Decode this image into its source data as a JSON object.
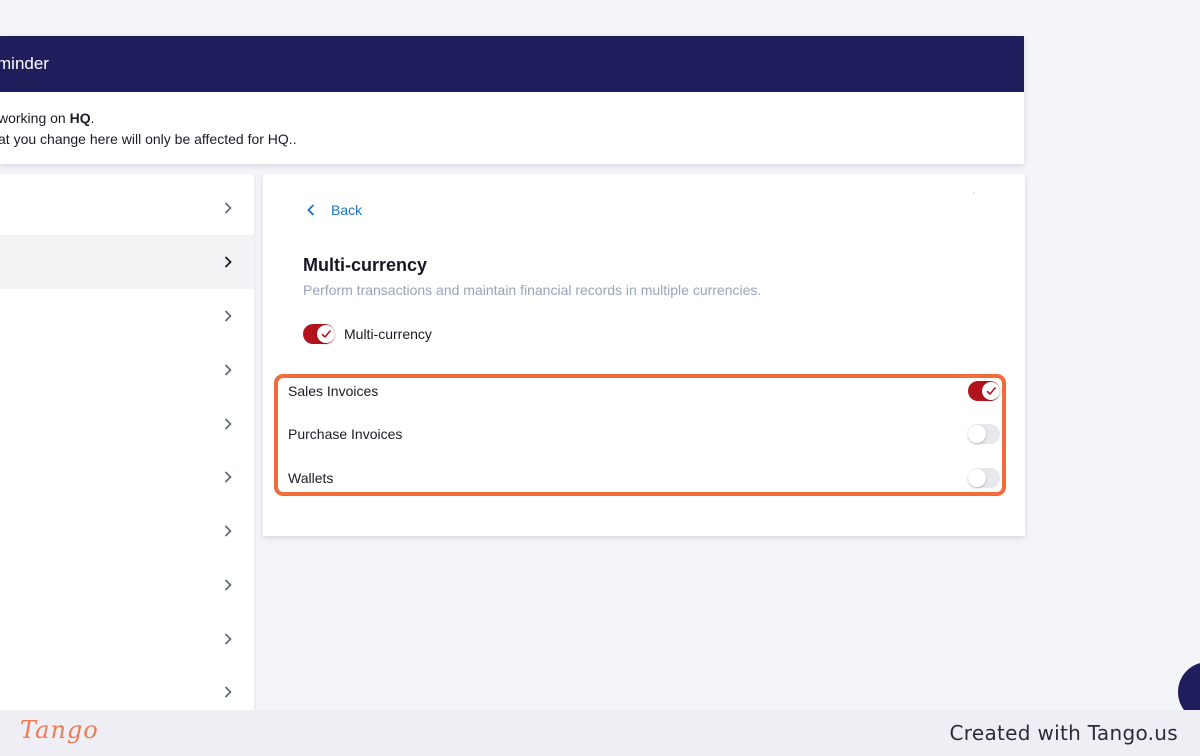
{
  "reminder": {
    "title": "minder",
    "line1_prefix": "working on ",
    "line1_bold": "HQ",
    "line1_suffix": ".",
    "line2": "at you change here will only be affected for HQ.."
  },
  "sidebar": {
    "items": [
      {
        "active": false
      },
      {
        "active": true
      },
      {
        "active": false
      },
      {
        "active": false
      },
      {
        "active": false
      },
      {
        "active": false
      },
      {
        "active": false
      },
      {
        "active": false
      },
      {
        "active": false
      },
      {
        "active": false
      }
    ]
  },
  "panel": {
    "back_label": "Back",
    "title": "Multi-currency",
    "description": "Perform transactions and maintain financial records in multiple currencies.",
    "master_toggle": {
      "label": "Multi-currency",
      "on": true
    },
    "options": [
      {
        "label": "Sales Invoices",
        "on": true
      },
      {
        "label": "Purchase Invoices",
        "on": false
      },
      {
        "label": "Wallets",
        "on": false
      }
    ]
  },
  "colors": {
    "header": "#1f1d5b",
    "toggle_on": "#b3131c",
    "highlight": "#f26b3a",
    "link": "#1a73c9"
  },
  "footer": {
    "logo": "Tango",
    "credit": "Created with Tango.us"
  }
}
